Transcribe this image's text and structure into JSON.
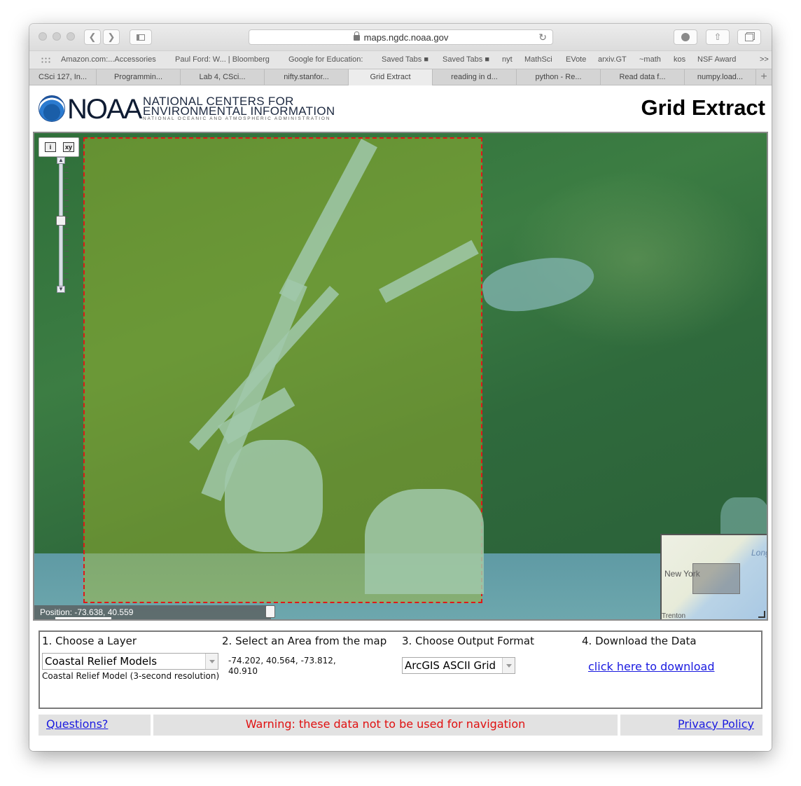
{
  "browser": {
    "url": "maps.ngdc.noaa.gov",
    "favorites": [
      "Amazon.com:...Accessories",
      "Paul Ford: W... | Bloomberg",
      "Google for Education:",
      "Saved Tabs ■",
      "Saved Tabs ■",
      "nyt",
      "MathSci",
      "EVote",
      "arxiv.GT",
      "~math",
      "kos",
      "NSF Award",
      ">>"
    ],
    "tabs": [
      "CSci 127, In...",
      "Programmin...",
      "Lab 4, CSci...",
      "nifty.stanfor...",
      "Grid Extract",
      "reading in d...",
      "python - Re...",
      "Read data f...",
      "numpy.load..."
    ],
    "active_tab": 4
  },
  "header": {
    "logo_text": "NOAA",
    "org_line1": "NATIONAL CENTERS FOR",
    "org_line2": "ENVIRONMENTAL INFORMATION",
    "org_line3": "NATIONAL OCEANIC AND ATMOSPHERIC ADMINISTRATION",
    "title": "Grid Extract"
  },
  "map": {
    "position_readout": "Position: -73.638, 40.559",
    "overview_labels": [
      "New York",
      "Long",
      "Trenton"
    ],
    "selection_color": "#e01818"
  },
  "steps": {
    "step1": {
      "title": "1. Choose a Layer",
      "selected": "Coastal Relief Models",
      "description": "Coastal Relief Model (3-second resolution)"
    },
    "step2": {
      "title": "2. Select an Area from the map",
      "coords_line1": "-74.202, 40.564, -73.812,",
      "coords_line2": "40.910"
    },
    "step3": {
      "title": "3. Choose Output Format",
      "selected": "ArcGIS ASCII Grid"
    },
    "step4": {
      "title": "4. Download the Data",
      "link": "click here to download"
    }
  },
  "footer": {
    "questions": "Questions?",
    "warning": "Warning: these data not to be used for navigation",
    "privacy": "Privacy Policy"
  }
}
